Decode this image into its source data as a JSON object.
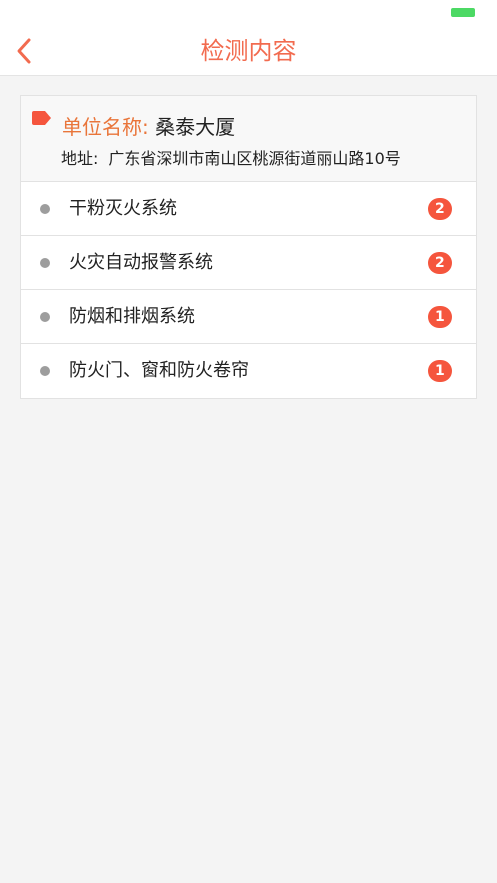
{
  "nav": {
    "title": "检测内容"
  },
  "unit": {
    "name_label": "单位名称:",
    "name": "桑泰大厦",
    "address_label": "地址:",
    "address": "广东省深圳市南山区桃源街道丽山路10号"
  },
  "items": [
    {
      "label": "干粉灭火系统",
      "count": "2"
    },
    {
      "label": "火灾自动报警系统",
      "count": "2"
    },
    {
      "label": "防烟和排烟系统",
      "count": "1"
    },
    {
      "label": "防火门、窗和防火卷帘",
      "count": "1"
    }
  ],
  "colors": {
    "accent": "#f26b4f",
    "badge": "#f5553d",
    "label_orange": "#e9753a",
    "battery": "#4cd964"
  },
  "icons": {
    "back": "chevron-left-icon",
    "tag": "tag-icon",
    "battery": "battery-icon"
  }
}
